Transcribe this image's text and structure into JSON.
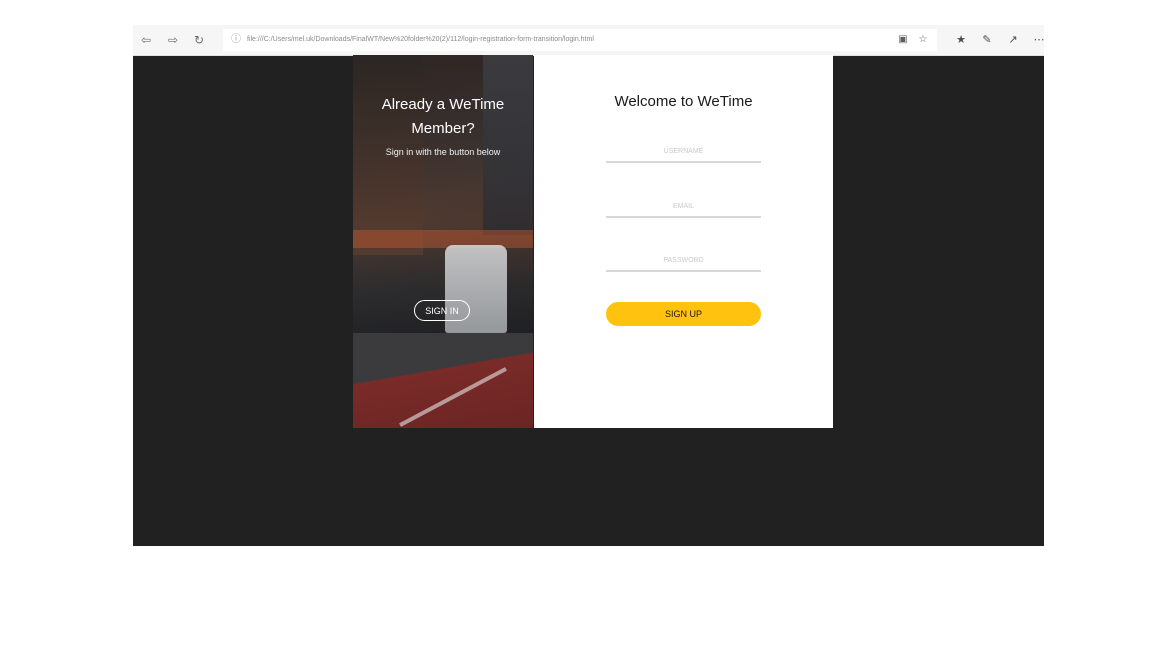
{
  "browser": {
    "url": "file:///C:/Users/mel.uk/Downloads/FinalWT/New%20folder%20(2)/112/login-registration-form-transition/login.html",
    "icons": {
      "back": "back-arrow-icon",
      "forward": "forward-arrow-icon",
      "refresh": "refresh-icon",
      "info": "info-icon",
      "reading_view": "reading-view-icon",
      "favorite": "star-icon",
      "favorites_bar": "favorites-icon",
      "pen": "pen-icon",
      "share": "share-icon",
      "more": "more-icon"
    }
  },
  "left_panel": {
    "title_line1": "Already a WeTime",
    "title_line2": "Member?",
    "subtitle": "Sign in with the button below",
    "signin_label": "SIGN IN"
  },
  "right_panel": {
    "title": "Welcome to WeTime",
    "username_placeholder": "USERNAME",
    "email_placeholder": "EMAIL",
    "password_placeholder": "PASSWORD",
    "signup_label": "SIGN UP"
  },
  "colors": {
    "accent": "#ffc20e",
    "page_background": "#212121"
  }
}
